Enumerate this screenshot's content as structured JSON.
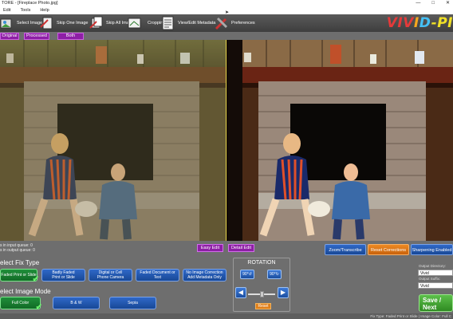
{
  "window": {
    "title": "TORE - [Fireplace Photo.jpg]",
    "minimize": "—",
    "maximize": "□",
    "close": "✕"
  },
  "menu": [
    "Edit",
    "Tools",
    "Help"
  ],
  "toolbar": {
    "items": [
      {
        "label": "Select Image(s)",
        "icon": "select-images-icon"
      },
      {
        "label": "Skip One Image",
        "icon": "skip-one-icon"
      },
      {
        "label": "Skip All Images",
        "icon": "skip-all-icon"
      },
      {
        "label": "Cropping",
        "icon": "crop-icon"
      },
      {
        "label": "View/Edit Metadata",
        "icon": "metadata-icon"
      },
      {
        "label": "Preferences",
        "icon": "tools-icon"
      }
    ],
    "logo": {
      "p1": "VIV",
      "p2": "I",
      "p3": "D",
      "p4": "-PI"
    }
  },
  "view_toggle": {
    "original": "Original",
    "processed": "Processed",
    "both": "Both"
  },
  "queue": {
    "input": "s in input queue:  0",
    "output": "s in output queue:  0"
  },
  "edit_modes": {
    "easy": "Easy Edit",
    "detail": "Detail Edit"
  },
  "actions": {
    "zoom": "Zoom/Transcribe",
    "reset": "Reset Corrections",
    "sharpen": "Sharpening Enabled"
  },
  "fix_type": {
    "label": "elect Fix Type",
    "options": [
      {
        "line1": "Faded Print or Slide",
        "line2": "",
        "selected": true
      },
      {
        "line1": "Badly Faded",
        "line2": "Print or Slide",
        "selected": false
      },
      {
        "line1": "Digital or Cell",
        "line2": "Phone Camera",
        "selected": false
      },
      {
        "line1": "Faded Document or",
        "line2": "Text",
        "selected": false
      },
      {
        "line1": "No Image Correction",
        "line2": "Add Metadata Only",
        "selected": false
      }
    ]
  },
  "image_mode": {
    "label": "elect Image Mode",
    "options": [
      {
        "label": "Full Color",
        "selected": true
      },
      {
        "label": "B & W",
        "selected": false
      },
      {
        "label": "Sepia",
        "selected": false
      }
    ]
  },
  "rotation": {
    "title": "ROTATION",
    "ccw": "90°",
    "cw": "90°",
    "left_arrow": "◀",
    "right_arrow": "▶",
    "level": 0.5,
    "reset": "Reset"
  },
  "output": {
    "dir_label": "Output Directory:",
    "dir_value": "Vivid",
    "suffix_label": "Output Suffix:",
    "suffix_value": "Vivid"
  },
  "save": {
    "line1": "Save /",
    "line2": "Next"
  },
  "status": "Fix Type: Faded Print or Slide | Image Color: Full C",
  "colors": {
    "purple": "#8e1fa6",
    "blue": "#2f68c8",
    "green": "#1f8f3a",
    "orange": "#e07f1a",
    "divider": "#e9d54a"
  }
}
